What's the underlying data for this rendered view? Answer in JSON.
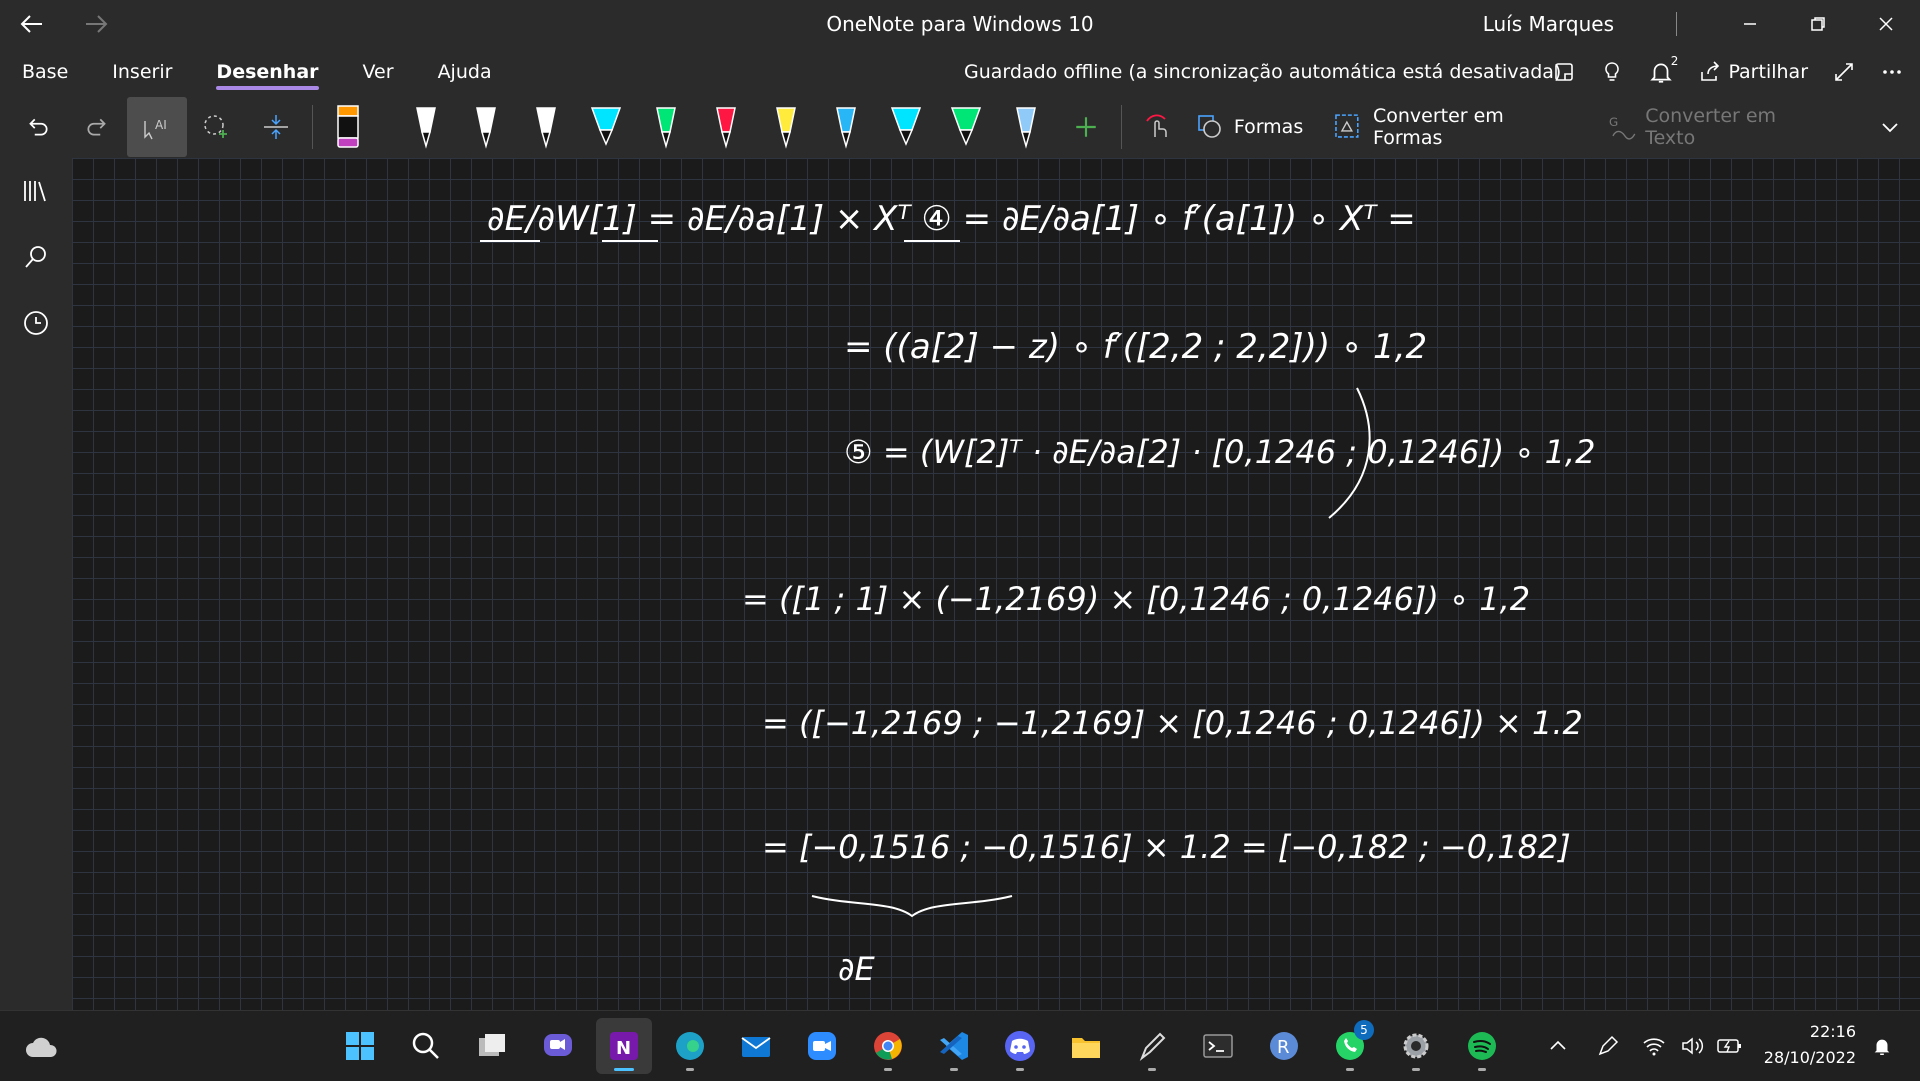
{
  "window": {
    "title": "OneNote para Windows 10",
    "user_name": "Luís Marques"
  },
  "menu": {
    "tabs": [
      "Base",
      "Inserir",
      "Desenhar",
      "Ver",
      "Ajuda"
    ],
    "active_tab": "Desenhar",
    "sync_status": "Guardado offline (a sincronização automática está desativada)",
    "notification_count": "2",
    "share_label": "Partilhar"
  },
  "toolbar": {
    "shapes_label": "Formas",
    "convert_shapes_label": "Converter em Formas",
    "convert_text_label": "Converter em Texto",
    "pen_colors": [
      "#ffffff",
      "#ffffff",
      "#ffffff",
      "#00e5ff",
      "#00e676",
      "#ff1744",
      "#ffeb3b",
      "#29b6f6",
      "#00e5ff",
      "#00e676",
      "#90caf9"
    ],
    "marker_colors": [
      "#ff9800",
      "#c040c0"
    ],
    "accent": "#a988e6"
  },
  "note": {
    "lines": [
      "∂E/∂W[1] = ∂E/∂a[1] × Xᵀ  ④  = ∂E/∂a[1] ∘ f′(a[1]) ∘ Xᵀ =",
      "= ((a[2] − z) ∘ f′([2,2 ; 2,2])) ∘ 1,2",
      "⑤ = (W[2]ᵀ · ∂E/∂a[2] · [0,1246 ; 0,1246]) ∘ 1,2",
      "= ([1 ; 1] × (−1,2169) × [0,1246 ; 0,1246]) ∘ 1,2",
      "= ([−1,2169 ; −1,2169] × [0,1246 ; 0,1246]) × 1.2",
      "= [−0,1516 ; −0,1516] × 1.2 = [−0,182 ; −0,182]",
      "∂E"
    ]
  },
  "taskbar": {
    "clock_time": "22:16",
    "clock_date": "28/10/2022",
    "whatsapp_badge": "5",
    "apps": [
      "start-icon",
      "search-icon",
      "task-view-icon",
      "chat-icon",
      "onenote-icon",
      "edge-icon",
      "mail-icon",
      "zoom-icon",
      "chrome-icon",
      "vscode-icon",
      "discord-icon",
      "file-explorer-icon",
      "pen-app-icon",
      "terminal-icon",
      "r-icon",
      "whatsapp-icon",
      "settings-icon",
      "spotify-icon"
    ]
  }
}
